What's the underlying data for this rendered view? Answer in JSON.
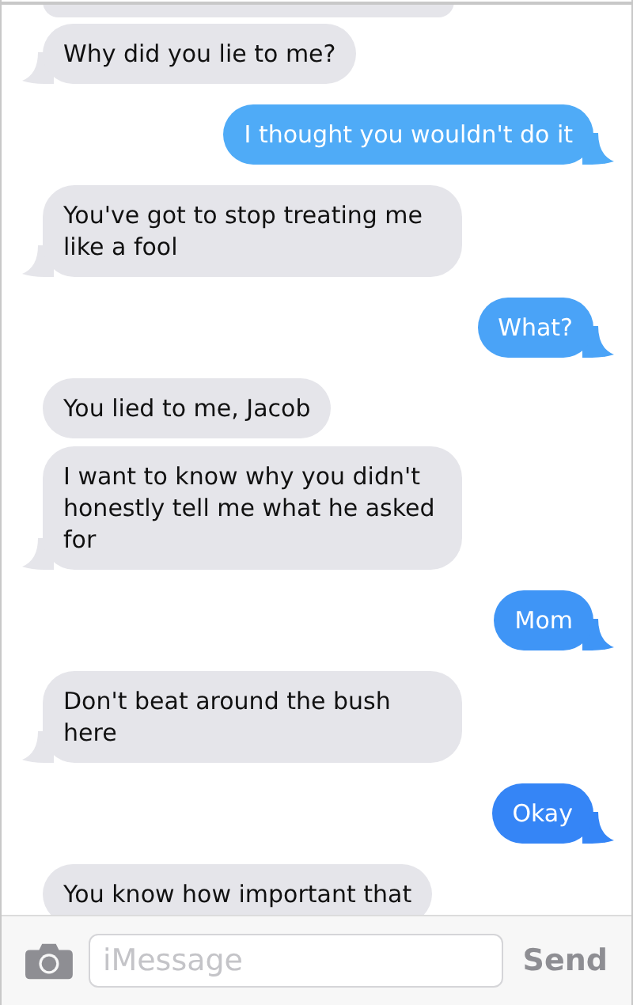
{
  "messages": [
    {
      "kind": "received",
      "text": "Why did you lie to me?",
      "tail": true
    },
    {
      "kind": "sent",
      "text": "I thought you wouldn't do it",
      "tail": true,
      "color": "#4fabf7"
    },
    {
      "kind": "received",
      "text": "You've got to stop treating me like a fool",
      "tail": true
    },
    {
      "kind": "sent",
      "text": "What?",
      "tail": true,
      "color": "#4aa3f7"
    },
    {
      "kind": "received",
      "text": "You lied to me, Jacob",
      "tail": false
    },
    {
      "kind": "received",
      "text": "I want to know why you didn't honestly tell me what he asked for",
      "tail": true
    },
    {
      "kind": "sent",
      "text": "Mom",
      "tail": true,
      "color": "#3f95f6"
    },
    {
      "kind": "received",
      "text": "Don't beat around the bush here",
      "tail": true
    },
    {
      "kind": "sent",
      "text": "Okay",
      "tail": true,
      "color": "#3585f6"
    },
    {
      "kind": "received",
      "text": "You know how important that",
      "tail": false
    }
  ],
  "composer": {
    "placeholder": "iMessage",
    "send": "Send"
  }
}
